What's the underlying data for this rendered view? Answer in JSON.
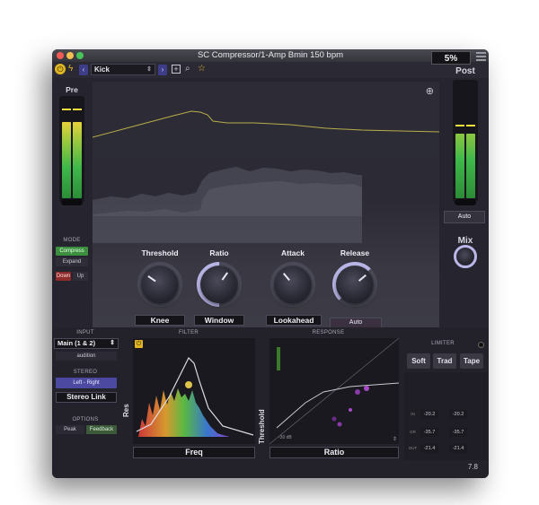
{
  "window": {
    "title": "SC Compressor/1-Amp Bmin 150 bpm",
    "cpu": "5%"
  },
  "toolbar": {
    "preset": "Kick",
    "prev": "‹",
    "next": "›",
    "power_icon": "power-icon",
    "bolt_icon": "bolt-icon"
  },
  "meters": {
    "pre_label": "Pre",
    "post_label": "Post",
    "post_auto": "Auto",
    "pre_level": 0.75,
    "post_level": 0.62
  },
  "mode": {
    "title": "MODE",
    "compress": "Compress",
    "expand": "Expand",
    "down": "Down",
    "up": "Up"
  },
  "knobs": {
    "threshold": "Threshold",
    "ratio": "Ratio",
    "attack": "Attack",
    "release": "Release",
    "mix": "Mix"
  },
  "fields": {
    "knee": "Knee",
    "window": "Window",
    "lookahead": "Lookahead",
    "auto": "Auto"
  },
  "input": {
    "title": "INPUT",
    "source": "Main (1 & 2)",
    "audition": "audition"
  },
  "stereo": {
    "title": "STEREO",
    "mode": "Left - Right",
    "link": "Stereo Link"
  },
  "options": {
    "title": "OPTIONS",
    "peak": "Peak",
    "feedback": "Feedback"
  },
  "filter": {
    "title": "FILTER",
    "xlabel": "Freq",
    "ylabel": "Res"
  },
  "response": {
    "title": "RESPONSE",
    "xlabel": "Ratio",
    "ylabel": "Threshold",
    "scale": "-30 dB"
  },
  "limiter": {
    "title": "LIMITER",
    "soft": "Soft",
    "trad": "Trad",
    "tape": "Tape",
    "rows": [
      {
        "l": "-20.2",
        "r": "-20.2"
      },
      {
        "l": "-35.7",
        "r": "-35.7"
      },
      {
        "l": "-21.4",
        "r": "-21.4"
      }
    ],
    "footer": "7.8"
  },
  "colors": {
    "accent": "#b9b6e8",
    "meter_green": "#3fb84a",
    "meter_yellow": "#e6d23a",
    "mode_green": "#3c8f3e",
    "mode_red": "#8e2c2c"
  }
}
